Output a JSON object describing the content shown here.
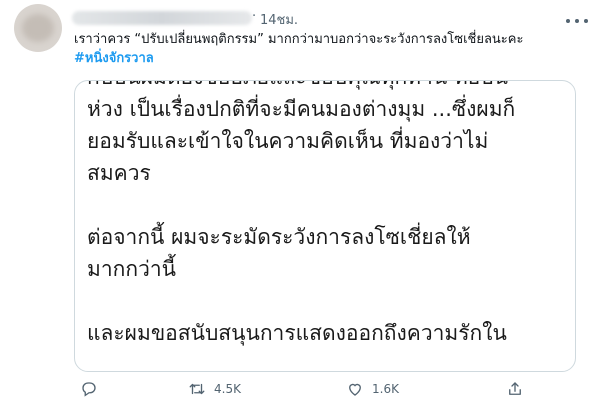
{
  "tweet": {
    "time": "14ชม.",
    "separator": "·",
    "text": "เราว่าควร “ปรับเปลี่ยนพฤติกรรม” มากกว่ามาบอกว่าจะระวังการลงโซเชี่ยลนะคะ",
    "hashtag": "#หนิ่งจักรวาล"
  },
  "card": {
    "lines": [
      "กับบนผมตองขออภัยและขอบคุณทุกทาน ทอบน",
      "ห่วง  เป็นเรื่องปกติที่จะมีคนมองต่างมุม ...ซึ่งผมก็",
      "ยอมรับและเข้าใจในความคิดเห็น ที่มองว่าไม่",
      "สมควร",
      "",
      "ต่อจากนี้ ผมจะระมัดระวังการลงโซเชี่ยลให้",
      "มากกว่านี้",
      "",
      "และผมขอสนับสนุนการแสดงออกถึงความรักใน"
    ]
  },
  "actions": {
    "reply_icon": "reply-icon",
    "retweet_icon": "retweet-icon",
    "retweet_count": "4.5K",
    "like_icon": "heart-icon",
    "like_count": "1.6K",
    "share_icon": "share-icon"
  },
  "colors": {
    "hashtag": "#1d9bf0",
    "secondary": "#536471",
    "border": "#cfd9de"
  }
}
